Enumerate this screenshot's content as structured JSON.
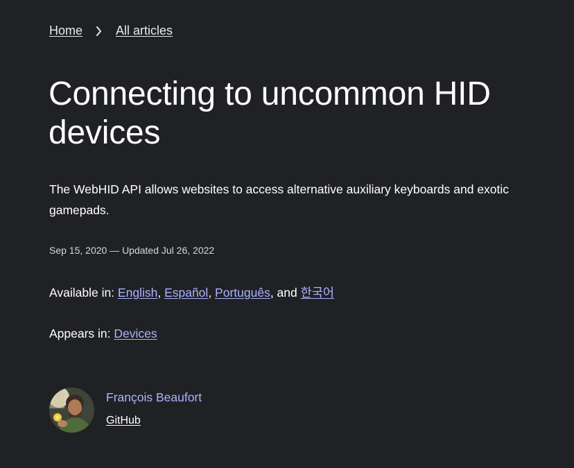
{
  "breadcrumb": {
    "home": "Home",
    "all_articles": "All articles"
  },
  "article": {
    "title": "Connecting to uncommon HID devices",
    "description": "The WebHID API allows websites to access alternative auxiliary keyboards and exotic gamepads.",
    "dates": "Sep 15, 2020 — Updated Jul 26, 2022"
  },
  "languages": {
    "prefix": "Available in: ",
    "items": [
      "English",
      "Español",
      "Português",
      "한국어"
    ],
    "separator_1": ", ",
    "separator_2": ", ",
    "separator_3": ", and "
  },
  "appears": {
    "prefix": "Appears in: ",
    "topic": "Devices"
  },
  "author": {
    "name": "François Beaufort",
    "link": "GitHub"
  },
  "colors": {
    "background": "#202124",
    "text": "#e8eaed",
    "link": "#aab4ff"
  }
}
